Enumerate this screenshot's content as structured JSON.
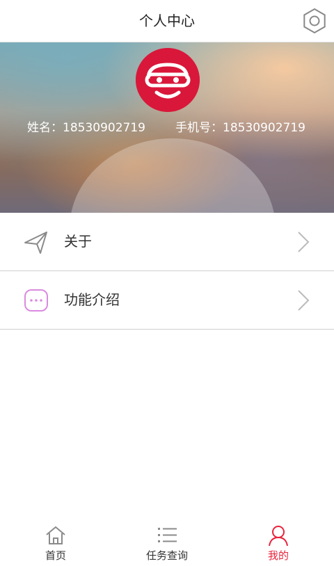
{
  "header": {
    "title": "个人中心",
    "settings_icon": "gear-icon"
  },
  "profile": {
    "avatar_icon": "car-logo-icon",
    "avatar_color": "#d9173a",
    "name_label": "姓名：",
    "name_value": "18530902719",
    "phone_label": "手机号：",
    "phone_value": "18530902719"
  },
  "menu": {
    "items": [
      {
        "label": "关于",
        "icon": "send-icon"
      },
      {
        "label": "功能介绍",
        "icon": "chat-bubble-icon"
      }
    ]
  },
  "tabbar": {
    "accent": "#e8243c",
    "tabs": [
      {
        "label": "首页",
        "icon": "home-icon",
        "active": false
      },
      {
        "label": "任务查询",
        "icon": "list-icon",
        "active": false
      },
      {
        "label": "我的",
        "icon": "user-icon",
        "active": true
      }
    ]
  }
}
